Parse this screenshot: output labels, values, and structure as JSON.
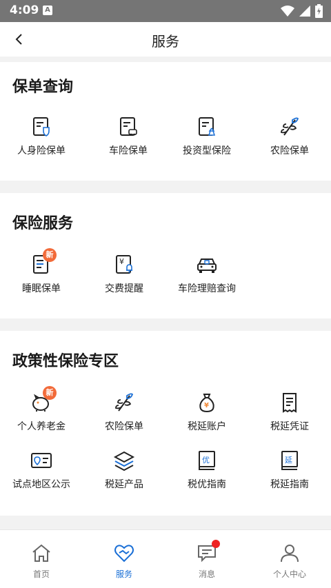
{
  "status_bar": {
    "time": "4:09",
    "notification_letter": "A"
  },
  "header": {
    "title": "服务"
  },
  "policy_query": {
    "title": "保单查询",
    "items": [
      {
        "label": "人身险保单",
        "icon": "person-policy-icon"
      },
      {
        "label": "车险保单",
        "icon": "car-policy-icon"
      },
      {
        "label": "投资型保险",
        "icon": "investment-policy-icon"
      },
      {
        "label": "农险保单",
        "icon": "agri-leaf-icon"
      }
    ]
  },
  "insurance_service": {
    "title": "保险服务",
    "items": [
      {
        "label": "睡眠保单",
        "icon": "dormant-policy-icon",
        "badge": "新"
      },
      {
        "label": "交费提醒",
        "icon": "payment-reminder-icon"
      },
      {
        "label": "车险理赔查询",
        "icon": "car-claim-icon"
      }
    ]
  },
  "policy_zone": {
    "title": "政策性保险专区",
    "items": [
      {
        "label": "个人养老金",
        "icon": "piggy-bank-icon",
        "badge": "新"
      },
      {
        "label": "农险保单",
        "icon": "agri-leaf-icon"
      },
      {
        "label": "税延账户",
        "icon": "money-bag-icon"
      },
      {
        "label": "税延凭证",
        "icon": "receipt-icon"
      },
      {
        "label": "试点地区公示",
        "icon": "map-card-icon"
      },
      {
        "label": "税延产品",
        "icon": "layers-icon"
      },
      {
        "label": "税优指南",
        "icon": "guide-book-icon",
        "glyph": "优"
      },
      {
        "label": "税延指南",
        "icon": "guide-book-icon",
        "glyph": "延"
      }
    ]
  },
  "bottom_nav": {
    "items": [
      {
        "label": "首页",
        "icon": "home-icon"
      },
      {
        "label": "服务",
        "icon": "service-heart-icon",
        "active": true
      },
      {
        "label": "消息",
        "icon": "message-icon"
      },
      {
        "label": "个人中心",
        "icon": "user-icon"
      }
    ]
  },
  "colors": {
    "accent": "#1a6fd6",
    "badge": "#f26b3a",
    "icon_orange": "#f28b3a",
    "dot": "#ee2222"
  }
}
